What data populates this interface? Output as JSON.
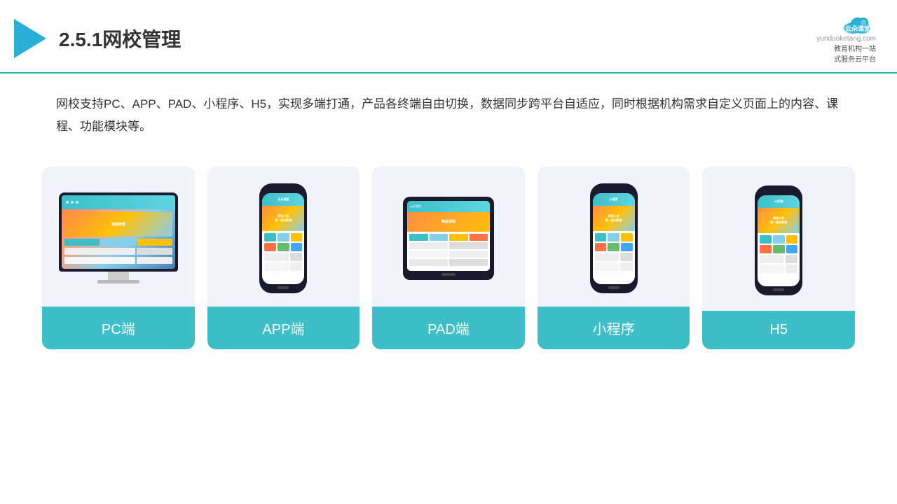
{
  "header": {
    "title": "2.5.1网校管理",
    "brand_name": "云朵课堂",
    "brand_url": "yunduoketang.com",
    "brand_tagline_line1": "教育机构一站",
    "brand_tagline_line2": "式服务云平台"
  },
  "description": {
    "text": "网校支持PC、APP、PAD、小程序、H5，实现多端打通，产品各终端自由切换，数据同步跨平台自适应，同时根据机构需求自定义页面上的内容、课程、功能模块等。"
  },
  "cards": [
    {
      "id": "pc",
      "label": "PC端",
      "type": "monitor"
    },
    {
      "id": "app",
      "label": "APP端",
      "type": "phone"
    },
    {
      "id": "pad",
      "label": "PAD端",
      "type": "tablet"
    },
    {
      "id": "mini",
      "label": "小程序",
      "type": "phone"
    },
    {
      "id": "h5",
      "label": "H5",
      "type": "phone"
    }
  ],
  "colors": {
    "accent": "#3dbfc9",
    "header_border": "#1cb8c8",
    "card_bg": "#f0f4fa",
    "card_label_bg": "#3dbfc9"
  }
}
